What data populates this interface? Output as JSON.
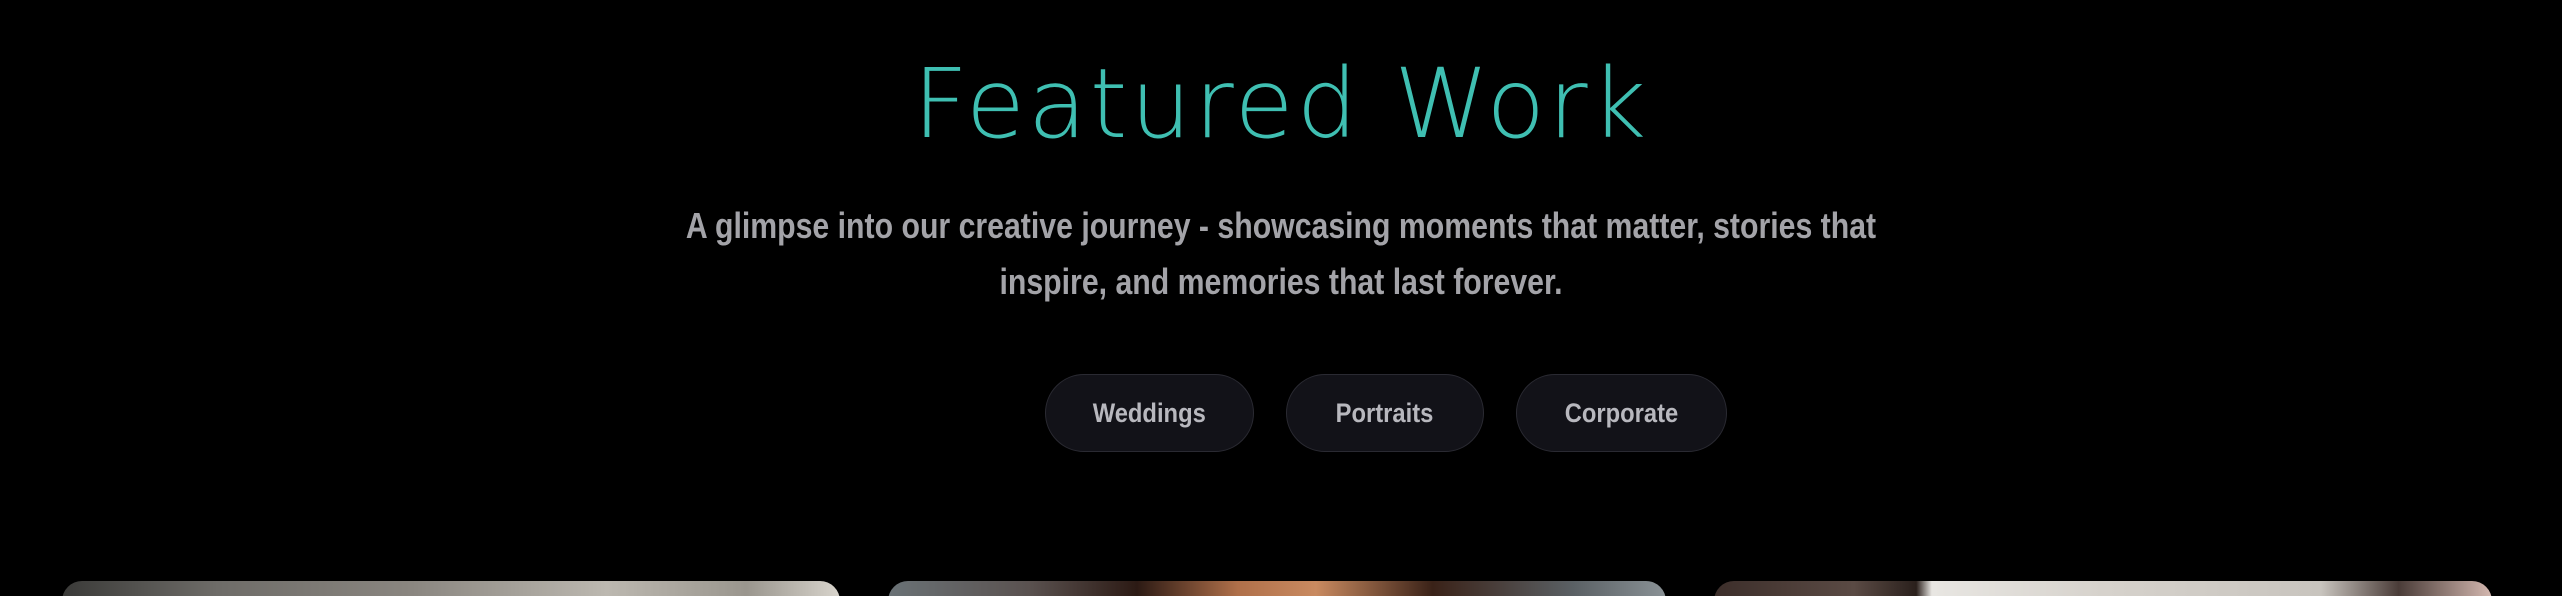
{
  "section": {
    "title": "Featured Work",
    "subtitle": "A glimpse into our creative journey - showcasing moments that matter, stories that inspire, and memories that last forever."
  },
  "filters": [
    {
      "label": "Weddings"
    },
    {
      "label": "Portraits"
    },
    {
      "label": "Corporate"
    }
  ],
  "colors": {
    "background": "#000000",
    "accent": "#3fbfb2",
    "subtitle": "#a3a3a8",
    "pill_background": "#121218",
    "pill_text": "#b8b8be"
  },
  "gallery": {
    "cards_visible": 3
  }
}
